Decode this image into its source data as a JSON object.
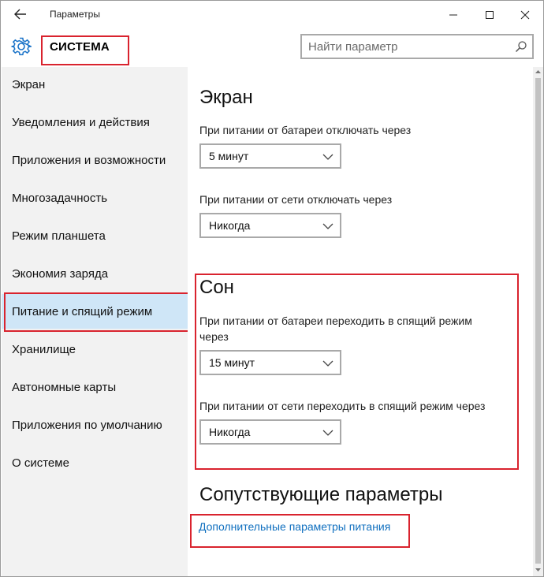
{
  "window": {
    "title": "Параметры",
    "controls": {
      "minimize": "minimize-icon",
      "maximize": "maximize-icon",
      "close": "close-icon"
    }
  },
  "header": {
    "section_title": "СИСТЕМА",
    "icon": "gear-icon",
    "search_placeholder": "Найти параметр"
  },
  "sidebar": {
    "items": [
      {
        "label": "Экран"
      },
      {
        "label": "Уведомления и действия"
      },
      {
        "label": "Приложения и возможности"
      },
      {
        "label": "Многозадачность"
      },
      {
        "label": "Режим планшета"
      },
      {
        "label": "Экономия заряда"
      },
      {
        "label": "Питание и спящий режим",
        "selected": true
      },
      {
        "label": "Хранилище"
      },
      {
        "label": "Автономные карты"
      },
      {
        "label": "Приложения по умолчанию"
      },
      {
        "label": "О системе"
      }
    ]
  },
  "main": {
    "screen": {
      "title": "Экран",
      "battery_label": "При питании от батареи отключать через",
      "battery_value": "5 минут",
      "ac_label": "При питании от сети отключать через",
      "ac_value": "Никогда"
    },
    "sleep": {
      "title": "Сон",
      "battery_label_line1": "При питании от батареи переходить в спящий режим",
      "battery_label_line2": "через",
      "battery_value": "15 минут",
      "ac_label": "При питании от сети переходить в спящий режим через",
      "ac_value": "Никогда"
    },
    "related": {
      "title": "Сопутствующие параметры",
      "link": "Дополнительные параметры питания"
    }
  },
  "colors": {
    "accent": "#0f6fbf",
    "highlight": "#d9232e",
    "sidebar_bg": "#f2f2f2",
    "selected_bg": "#cfe6f7"
  }
}
